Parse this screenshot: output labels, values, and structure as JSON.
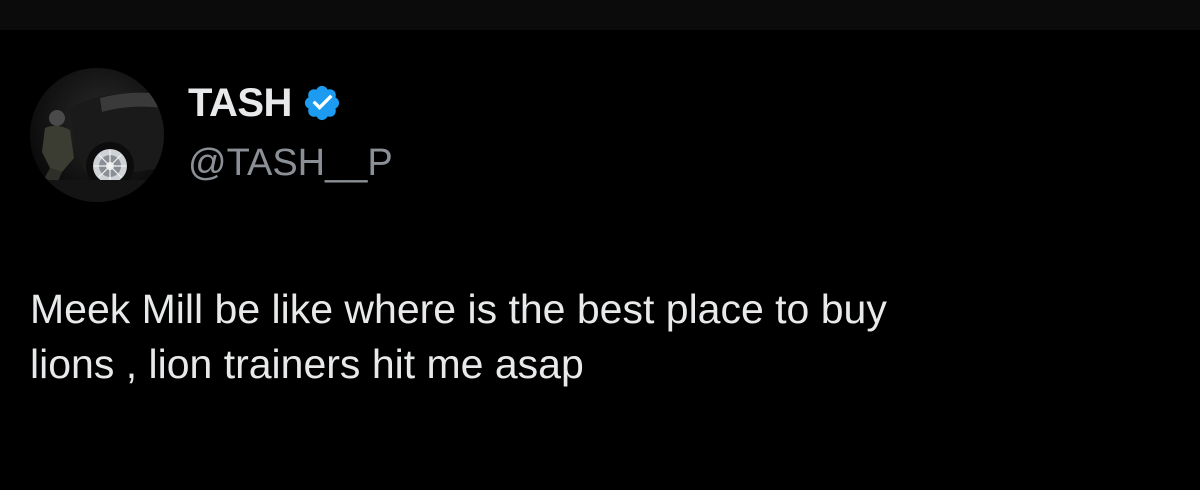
{
  "tweet": {
    "author": {
      "display_name": "TASH",
      "handle": "@TASH__P",
      "verified": true,
      "avatar_icon": "user-avatar-photo",
      "verified_icon": "verified-badge-icon"
    },
    "text_line1": "Meek Mill be like where is the best place to buy",
    "text_line2": "lions , lion trainers hit me asap"
  },
  "colors": {
    "background": "#000000",
    "top_bar": "#0b0b0b",
    "primary_text": "#e7e9ea",
    "secondary_text": "#8b9096",
    "verified_blue": "#1d9bf0"
  }
}
